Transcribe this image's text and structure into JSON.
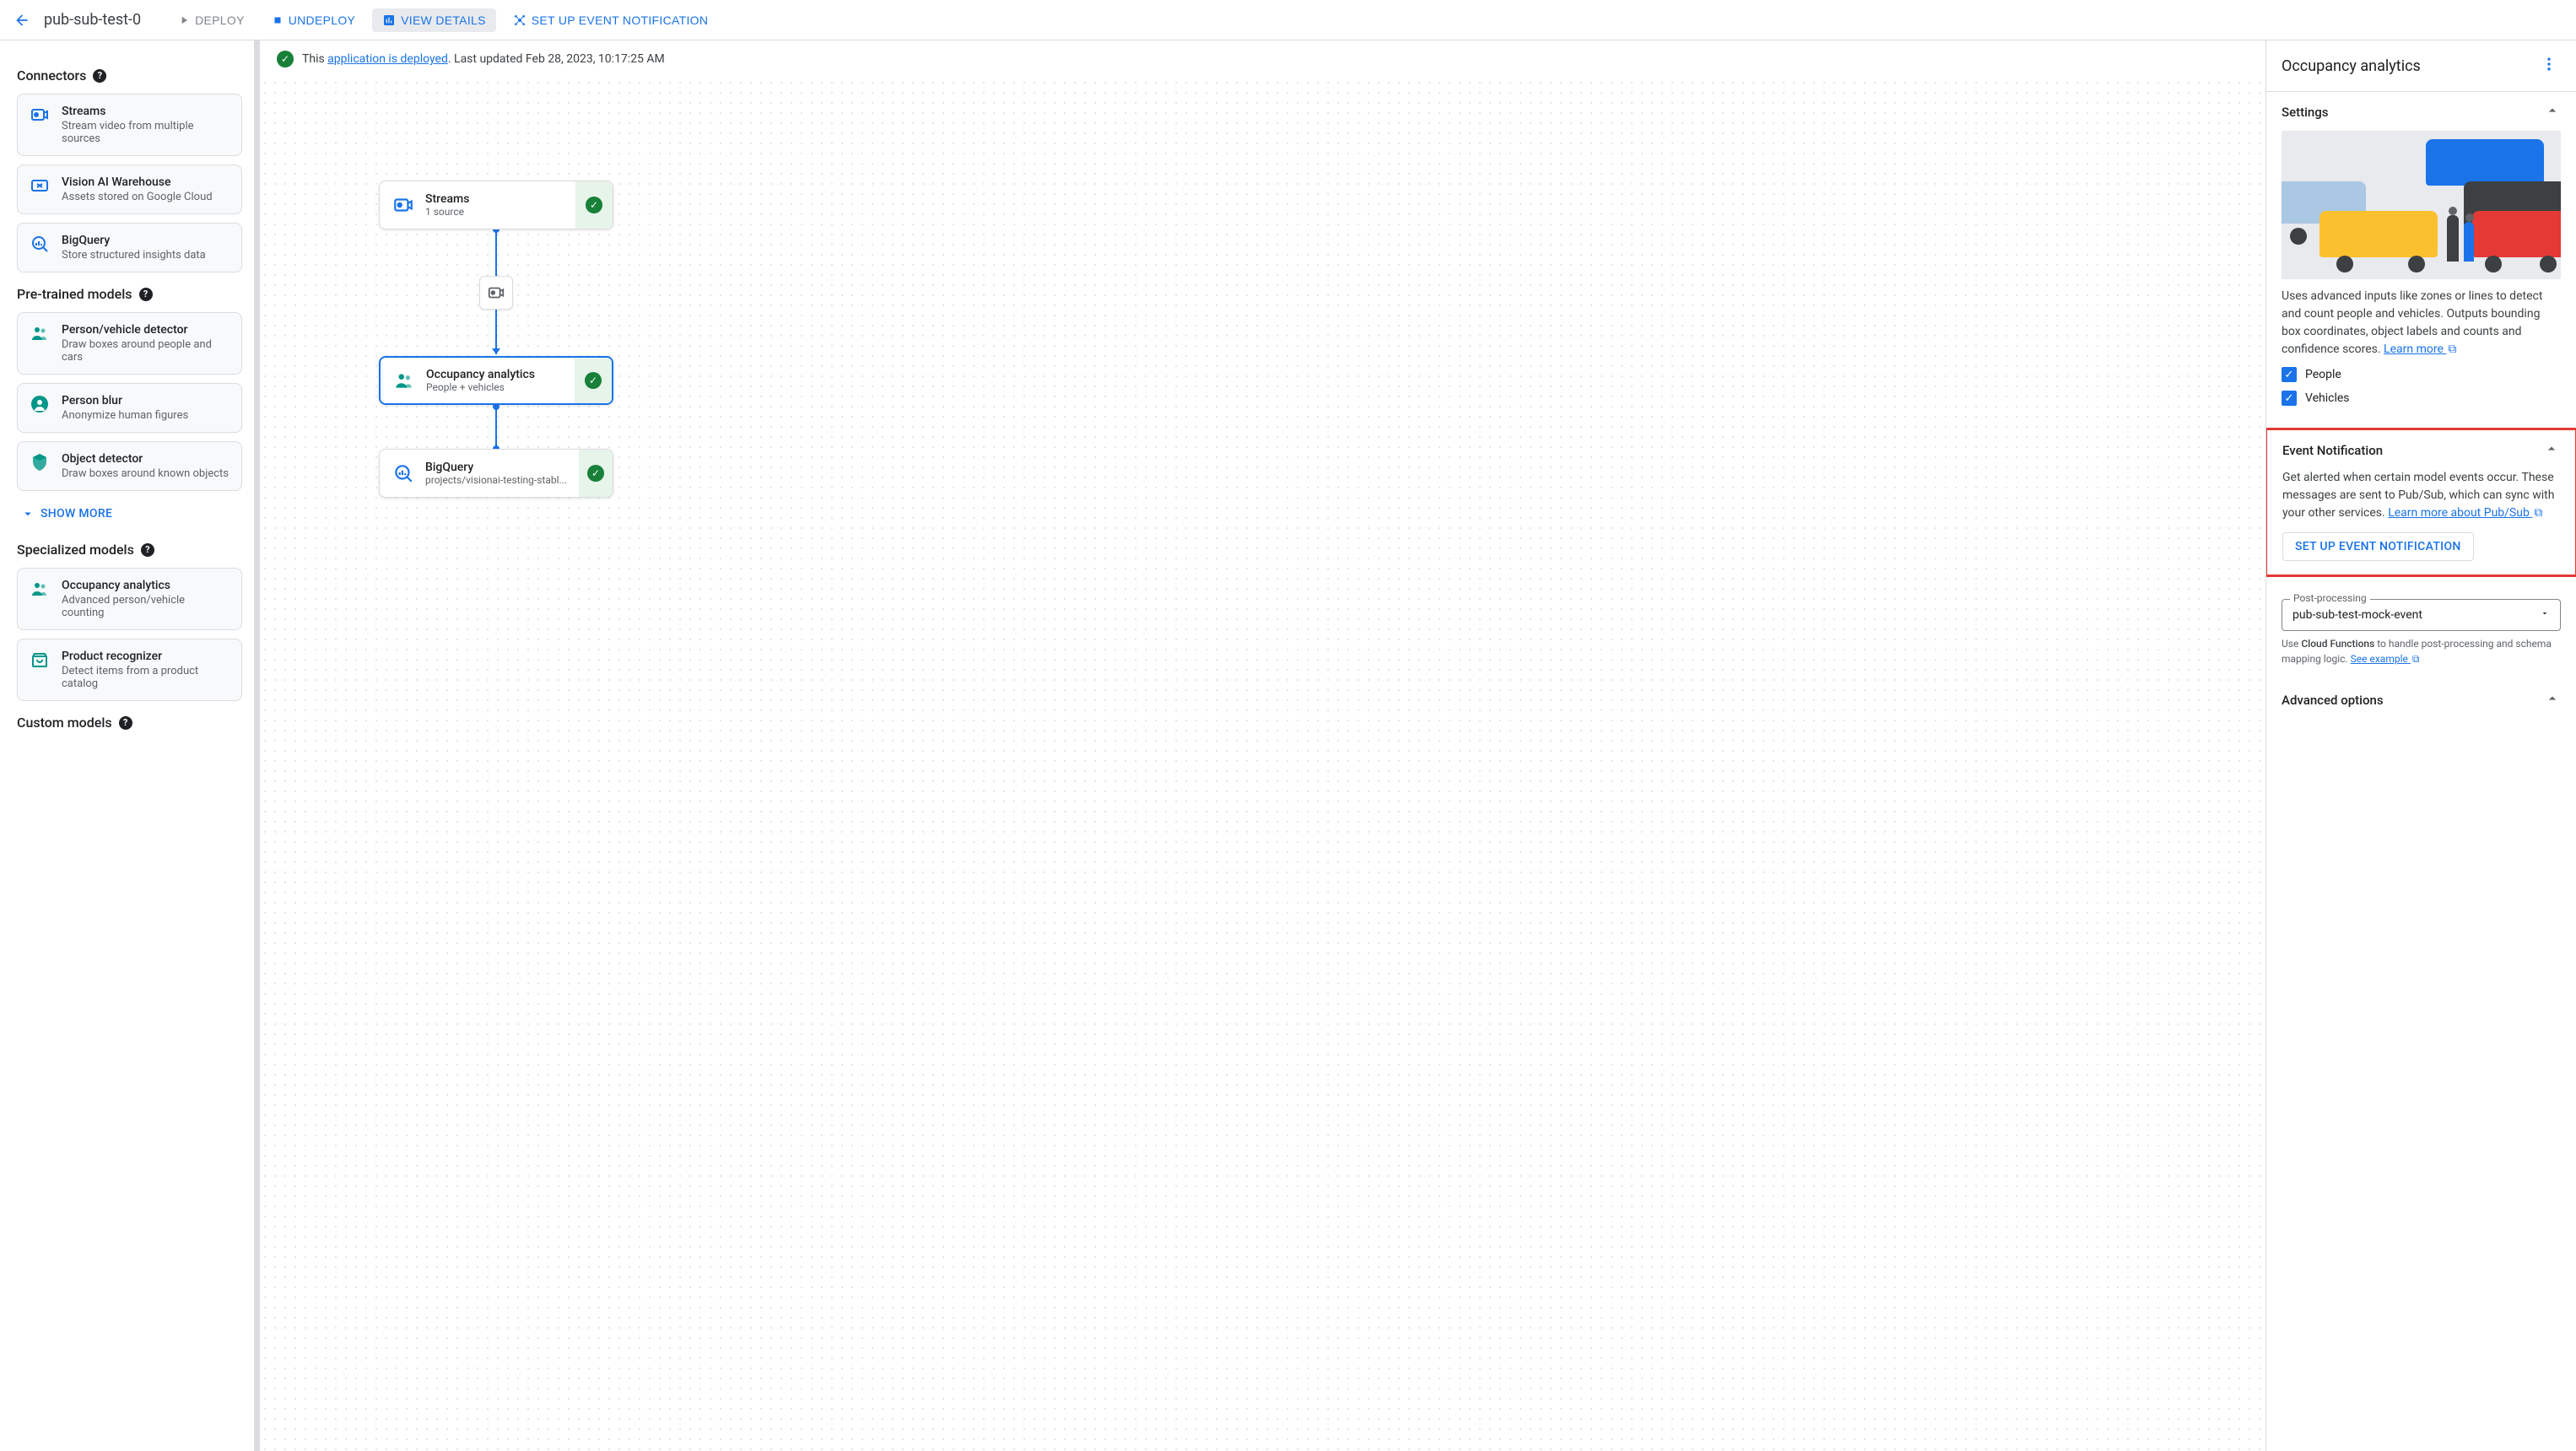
{
  "header": {
    "title": "pub-sub-test-0",
    "deploy": "DEPLOY",
    "undeploy": "UNDEPLOY",
    "view_details": "VIEW DETAILS",
    "setup_event": "SET UP EVENT NOTIFICATION"
  },
  "status": {
    "prefix": "This ",
    "link": "application is deployed",
    "suffix": ". Last updated Feb 28, 2023, 10:17:25 AM"
  },
  "sidebar": {
    "sections": {
      "connectors": {
        "title": "Connectors",
        "items": [
          {
            "title": "Streams",
            "sub": "Stream video from multiple sources",
            "icon": "streams"
          },
          {
            "title": "Vision AI Warehouse",
            "sub": "Assets stored on Google Cloud",
            "icon": "warehouse"
          },
          {
            "title": "BigQuery",
            "sub": "Store structured insights data",
            "icon": "bigquery"
          }
        ]
      },
      "pretrained": {
        "title": "Pre-trained models",
        "items": [
          {
            "title": "Person/vehicle detector",
            "sub": "Draw boxes around people and cars",
            "icon": "people"
          },
          {
            "title": "Person blur",
            "sub": "Anonymize human figures",
            "icon": "blur"
          },
          {
            "title": "Object detector",
            "sub": "Draw boxes around known objects",
            "icon": "object"
          }
        ],
        "show_more": "SHOW MORE"
      },
      "specialized": {
        "title": "Specialized models",
        "items": [
          {
            "title": "Occupancy analytics",
            "sub": "Advanced person/vehicle counting",
            "icon": "people"
          },
          {
            "title": "Product recognizer",
            "sub": "Detect items from a product catalog",
            "icon": "product"
          }
        ]
      },
      "custom": {
        "title": "Custom models"
      }
    }
  },
  "graph": {
    "nodes": {
      "streams": {
        "title": "Streams",
        "sub": "1 source"
      },
      "occupancy": {
        "title": "Occupancy analytics",
        "sub": "People + vehicles"
      },
      "bigquery": {
        "title": "BigQuery",
        "sub": "projects/visionai-testing-stabl..."
      }
    }
  },
  "rightpanel": {
    "title": "Occupancy analytics",
    "settings": {
      "title": "Settings",
      "desc": "Uses advanced inputs like zones or lines to detect and count people and vehicles. Outputs bounding box coordinates, object labels and counts and confidence scores. ",
      "learn_more": "Learn more",
      "people": "People",
      "vehicles": "Vehicles"
    },
    "event": {
      "title": "Event Notification",
      "desc": "Get alerted when certain model events occur. These messages are sent to Pub/Sub, which can sync with your other services. ",
      "learn_more": "Learn more about Pub/Sub",
      "button": "SET UP EVENT NOTIFICATION"
    },
    "postprocessing": {
      "label": "Post-processing",
      "value": "pub-sub-test-mock-event",
      "help_prefix": "Use ",
      "help_bold": "Cloud Functions",
      "help_suffix": " to handle post-processing and schema mapping logic. ",
      "see_example": "See example"
    },
    "advanced": {
      "title": "Advanced options"
    }
  }
}
